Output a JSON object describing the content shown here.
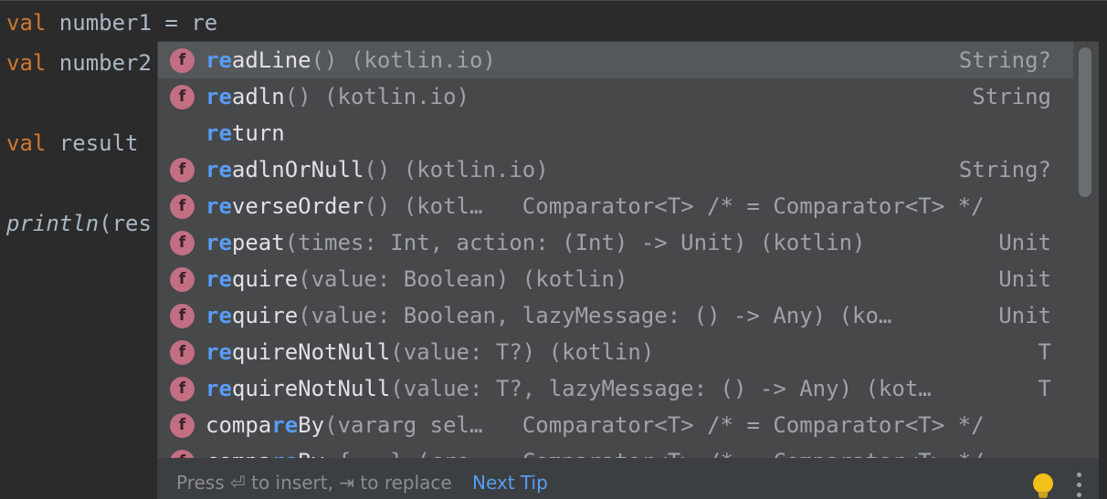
{
  "editor": {
    "line1": {
      "kw": "val",
      "text": " number1 = re"
    },
    "line2": {
      "kw": "val",
      "text": " number2"
    },
    "line3": {
      "kw": "val",
      "text": " result"
    },
    "line4": {
      "fn": "println",
      "text": "(res"
    }
  },
  "completion": {
    "items": [
      {
        "icon": "f",
        "hl": "re",
        "rest": "adLine",
        "tail": "() (kotlin.io)",
        "type": "String?",
        "selected": true
      },
      {
        "icon": "f",
        "hl": "re",
        "rest": "adln",
        "tail": "() (kotlin.io)",
        "type": "String"
      },
      {
        "icon": "",
        "hl": "re",
        "rest": "turn",
        "tail": "",
        "type": ""
      },
      {
        "icon": "f",
        "hl": "re",
        "rest": "adlnOrNull",
        "tail": "() (kotlin.io)",
        "type": "String?"
      },
      {
        "icon": "f",
        "hl": "re",
        "rest": "verseOrder",
        "tail": "() (kotl…   Comparator<T> /* = Comparator<T> */",
        "type": ""
      },
      {
        "icon": "f",
        "hl": "re",
        "rest": "peat",
        "tail": "(times: Int, action: (Int) -> Unit) (kotlin)",
        "type": "Unit"
      },
      {
        "icon": "f",
        "hl": "re",
        "rest": "quire",
        "tail": "(value: Boolean) (kotlin)",
        "type": "Unit"
      },
      {
        "icon": "f",
        "hl": "re",
        "rest": "quire",
        "tail": "(value: Boolean, lazyMessage: () -> Any) (ko…",
        "type": "Unit"
      },
      {
        "icon": "f",
        "hl": "re",
        "rest": "quireNotNull",
        "tail": "(value: T?) (kotlin)",
        "type": "T"
      },
      {
        "icon": "f",
        "hl": "re",
        "rest": "quireNotNull",
        "tail": "(value: T?, lazyMessage: () -> Any) (kot…",
        "type": "T"
      },
      {
        "icon": "f",
        "pre": "compa",
        "hl": "re",
        "rest": "By",
        "tail": "(vararg sel…   Comparator<T> /* = Comparator<T> */",
        "type": ""
      },
      {
        "icon": "f",
        "pre": "compa",
        "hl": "re",
        "rest": "By",
        "tail": " {...} (cre…   Comparator<T> /* = Comparator<T> */",
        "type": ""
      }
    ],
    "footer": {
      "hint": "Press ⏎ to insert, ⇥ to replace",
      "next_tip": "Next Tip"
    }
  }
}
